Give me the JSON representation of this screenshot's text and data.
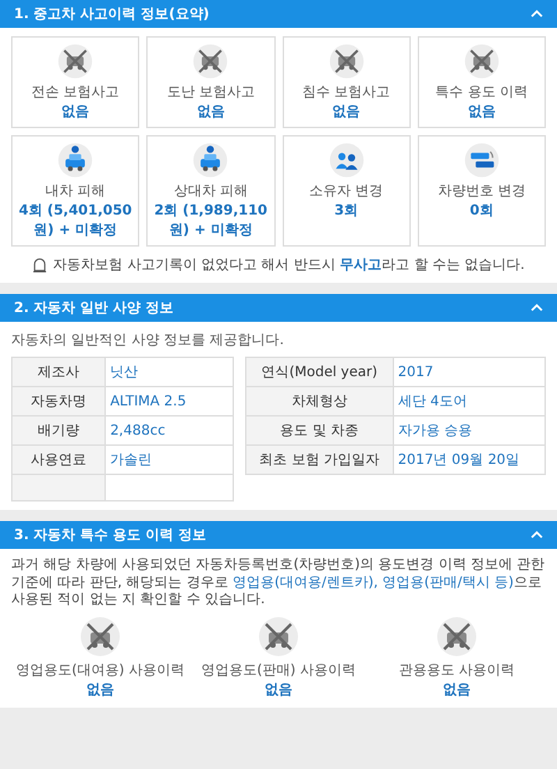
{
  "sections": [
    {
      "title": "1. 중고차 사고이력 정보(요약)",
      "expanded": true,
      "cards": [
        {
          "label": "전손 보험사고",
          "value": "없음"
        },
        {
          "label": "도난 보험사고",
          "value": "없음"
        },
        {
          "label": "침수 보험사고",
          "value": "없음"
        },
        {
          "label": "특수 용도 이력",
          "value": "없음"
        },
        {
          "label": "내차 피해",
          "value": "4회 (5,401,050 원) + 미확정"
        },
        {
          "label": "상대차 피해",
          "value": "2회 (1,989,110 원) + 미확정"
        },
        {
          "label": "소유자 변경",
          "value": "3회"
        },
        {
          "label": "차량번호 변경",
          "value": "0회"
        }
      ],
      "notice": "자동차보험 사고기록이 없었다고 해서 반드시 **무사고**라고 할 수는 없습니다."
    },
    {
      "title": "2. 자동차 일반 사양 정보",
      "expanded": true,
      "note": "자동차의 일반적인 사양 정보를 제공합니다.",
      "tables": [
        [
          {
            "label": "제조사",
            "value": "닛산"
          },
          {
            "label": "자동차명",
            "value": "ALTIMA 2.5"
          },
          {
            "label": "배기량",
            "value": "2,488cc"
          },
          {
            "label": "사용연료",
            "value": "가솔린"
          }
        ],
        [
          {
            "label": "연식(Model year)",
            "value": "2017"
          },
          {
            "label": "차체형상",
            "value": "세단 4도어"
          },
          {
            "label": "용도 및 차종",
            "value": "자가용 승용"
          },
          {
            "label": "최초 보험 가입일자",
            "value": "2017년 09월 20일"
          }
        ]
      ]
    },
    {
      "title": "3. 자동차 특수 용도 이력 정보",
      "expanded": true,
      "paragraph": [
        {
          "text": "과거 해당 차량에 사용되었던 자동차등록번호(차량번호)의 용도변경 이력 정보에 관한 기준에 따라 판단, 해당되는 경우로 ",
          "link": false
        },
        {
          "text": "영업용(대여용/렌트카), 영업용(판매/택시 등)",
          "link": true
        },
        {
          "text": "으로 사용된 적이 없는 지 확인할 수 있습니다.",
          "link": false
        }
      ],
      "cards": [
        {
          "label": "영업용도(대여용) 사용이력",
          "value": "없음"
        },
        {
          "label": "영업용도(판매) 사용이력",
          "value": "없음"
        },
        {
          "label": "관용용도 사용이력",
          "value": "없음"
        }
      ]
    }
  ]
}
